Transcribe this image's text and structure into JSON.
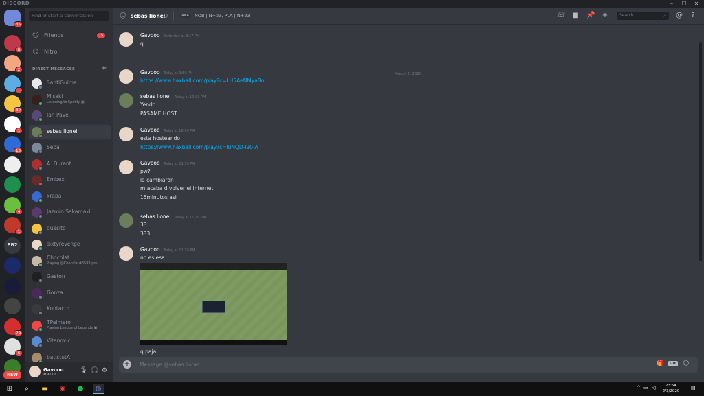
{
  "window": {
    "title": "DISCORD",
    "min": "–",
    "max": "☐",
    "close": "✕"
  },
  "guilds": [
    {
      "name": "home",
      "color": "#7289da",
      "badge": "35"
    },
    {
      "name": "server-1",
      "color": "#c0394a",
      "badge": "8"
    },
    {
      "name": "server-2",
      "color": "#f4a582",
      "badge": "2"
    },
    {
      "name": "server-3",
      "color": "#5dade2",
      "badge": "1"
    },
    {
      "name": "server-4",
      "color": "#f5c542",
      "badge": "30"
    },
    {
      "name": "server-5",
      "color": "#ffffff",
      "badge": "1"
    },
    {
      "name": "server-6",
      "color": "#2e6bd6",
      "badge": "13"
    },
    {
      "name": "server-7",
      "color": "#eeeeee",
      "badge": ""
    },
    {
      "name": "server-8",
      "color": "#1e8f4e",
      "badge": ""
    },
    {
      "name": "server-9",
      "color": "#6abf3f",
      "badge": "4"
    },
    {
      "name": "server-10",
      "color": "#c0392b",
      "badge": "1"
    },
    {
      "name": "server-11",
      "color": "#36393f",
      "badge": "",
      "label": "PB2"
    },
    {
      "name": "server-12",
      "color": "#1b2a6b",
      "badge": ""
    },
    {
      "name": "server-13",
      "color": "#1a1a3a",
      "badge": ""
    },
    {
      "name": "server-14",
      "color": "#444444",
      "badge": ""
    },
    {
      "name": "server-15",
      "color": "#d32f2f",
      "badge": "29"
    },
    {
      "name": "server-16",
      "color": "#e0e0e0",
      "badge": "6"
    },
    {
      "name": "server-17",
      "color": "#3a7d2a",
      "badge": ""
    }
  ],
  "new_label": "NEW",
  "sidebar": {
    "search_placeholder": "Find or start a conversation",
    "friends_label": "Friends",
    "friends_badge": "15",
    "nitro_label": "Nitro",
    "dm_header": "DIRECT MESSAGES",
    "dm_add": "+",
    "dms": [
      {
        "name": "SantiGuima",
        "sub": "",
        "color": "#e8e8e8",
        "status": "#747f8d"
      },
      {
        "name": "Misaki",
        "sub": "Listening to Spotify ▣",
        "color": "#3a1d1d",
        "status": "#43b581"
      },
      {
        "name": "Ian Pave",
        "sub": "",
        "color": "#5a4a7a",
        "status": "#43b581"
      },
      {
        "name": "sebas lionel",
        "sub": "",
        "color": "#6b7d5a",
        "status": "#747f8d",
        "active": true
      },
      {
        "name": "Seba",
        "sub": "",
        "color": "#7a8a9a",
        "status": "#747f8d"
      },
      {
        "name": "A. Durant",
        "sub": "",
        "color": "#b03030",
        "status": "#747f8d"
      },
      {
        "name": "Embex",
        "sub": "",
        "color": "#6a2a2a",
        "status": "#f04747"
      },
      {
        "name": "krapa",
        "sub": "",
        "color": "#3a6ad0",
        "status": "#43b581"
      },
      {
        "name": "Jazmin Sakamaki",
        "sub": "",
        "color": "#5a3a6a",
        "status": "#747f8d"
      },
      {
        "name": "quesito",
        "sub": "",
        "color": "#f5c542",
        "status": "#747f8d"
      },
      {
        "name": "sixtyrevenge",
        "sub": "",
        "color": "#e8d9c8",
        "status": "#43b581"
      },
      {
        "name": "Chocolat",
        "sub": "Playing @Chocolat#6583 pre...",
        "color": "#c8b8a8",
        "status": "#43b581"
      },
      {
        "name": "Gaston",
        "sub": "",
        "color": "#202020",
        "status": "#747f8d"
      },
      {
        "name": "Gonza",
        "sub": "",
        "color": "#4a2a5a",
        "status": "#747f8d"
      },
      {
        "name": "Kontacto",
        "sub": "",
        "color": "#3a3a3a",
        "status": "#747f8d"
      },
      {
        "name": "TPalmero",
        "sub": "Playing League of Legends ▣",
        "color": "#f04747",
        "status": "#43b581"
      },
      {
        "name": "Vitanovic",
        "sub": "",
        "color": "#5a8ad0",
        "status": "#747f8d"
      },
      {
        "name": "batistutA",
        "sub": "",
        "color": "#a88a6a",
        "status": "#43b581"
      }
    ]
  },
  "user": {
    "name": "Gavooo",
    "tag": "#9777"
  },
  "header": {
    "channel_name": "sebas lionel",
    "aka": "AKA",
    "nicknames": "NOB | N+23, PLA | N+23",
    "search_placeholder": "Search"
  },
  "chat": {
    "divider_date": "March 2, 2020",
    "messages": [
      {
        "author": "Gavooo",
        "time": "Yesterday at 3:17 PM",
        "avatar": "#e8d6c8",
        "lines": [
          {
            "text": "q",
            "link": false
          }
        ]
      },
      {
        "author": "Gavooo",
        "time": "Today at 9:59 PM",
        "avatar": "#e8d6c8",
        "lines": [
          {
            "text": "https://www.haxball.com/play?c=LH5AeNMya8o",
            "link": true
          }
        ]
      },
      {
        "author": "sebas lionel",
        "time": "Today at 10:00 PM",
        "avatar": "#6b7d5a",
        "lines": [
          {
            "text": "Yendo",
            "link": false
          },
          {
            "text": "PASAME HOST",
            "link": false
          }
        ]
      },
      {
        "author": "Gavooo",
        "time": "Today at 10:06 PM",
        "avatar": "#e8d6c8",
        "lines": [
          {
            "text": "esta hosteando",
            "link": false
          },
          {
            "text": "https://www.haxball.com/play?c=luNQD-l90-A",
            "link": true
          }
        ]
      },
      {
        "author": "Gavooo",
        "time": "Today at 11:10 PM",
        "avatar": "#e8d6c8",
        "lines": [
          {
            "text": "pw?",
            "link": false
          },
          {
            "text": "la cambiaron",
            "link": false
          },
          {
            "text": "m acaba d volver el internet",
            "link": false
          },
          {
            "text": "15minutos asi",
            "link": false
          }
        ]
      },
      {
        "author": "sebas lionel",
        "time": "Today at 11:10 PM",
        "avatar": "#6b7d5a",
        "lines": [
          {
            "text": "33",
            "link": false
          },
          {
            "text": "333",
            "link": false
          }
        ]
      },
      {
        "author": "Gavooo",
        "time": "Today at 11:10 PM",
        "avatar": "#e8d6c8",
        "lines": [
          {
            "text": "no es esa",
            "link": false
          }
        ]
      }
    ],
    "after_image": "q paja"
  },
  "composer": {
    "placeholder": "Message @sebas lionel",
    "gif": "GIF"
  },
  "taskbar": {
    "time": "23:54",
    "date": "2/3/2020"
  }
}
